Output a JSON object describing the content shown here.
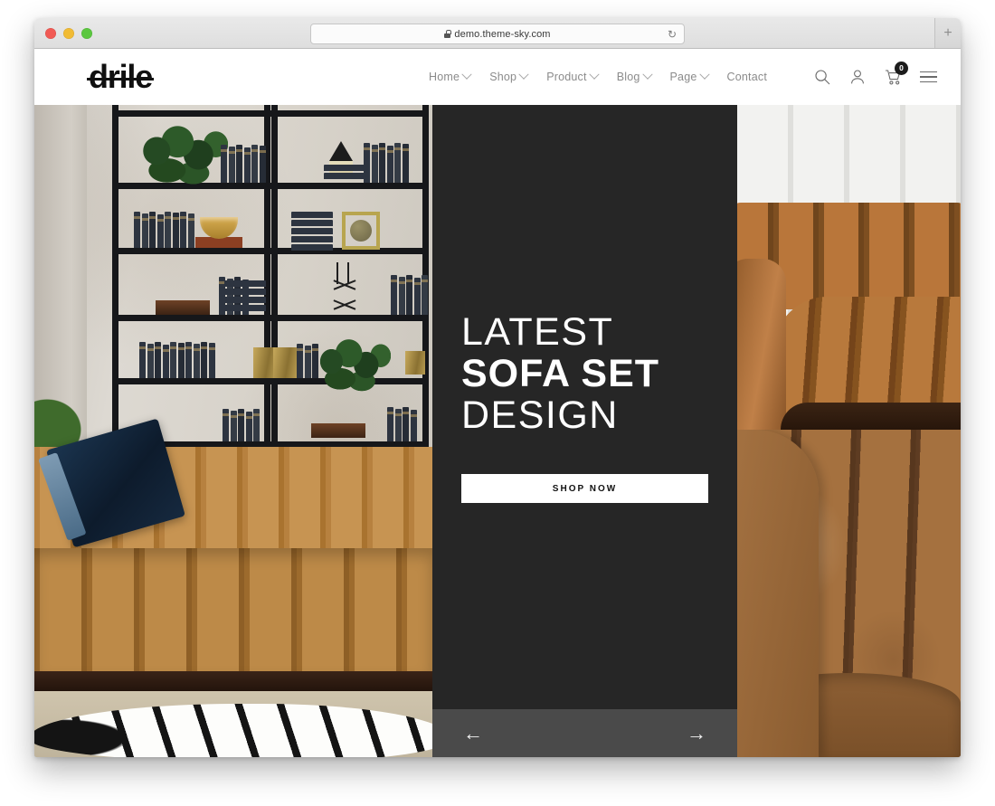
{
  "browser": {
    "url": "demo.theme-sky.com",
    "lock_icon": "lock-icon",
    "reload_icon": "reload-icon",
    "newtab_label": "+",
    "traffic_lights": [
      "close",
      "minimize",
      "zoom"
    ]
  },
  "header": {
    "logo": "drile",
    "nav": [
      {
        "label": "Home",
        "has_dropdown": true
      },
      {
        "label": "Shop",
        "has_dropdown": true
      },
      {
        "label": "Product",
        "has_dropdown": true
      },
      {
        "label": "Blog",
        "has_dropdown": true
      },
      {
        "label": "Page",
        "has_dropdown": true
      },
      {
        "label": "Contact",
        "has_dropdown": false
      }
    ],
    "icons": {
      "search": "search-icon",
      "account": "user-icon",
      "cart": "cart-icon",
      "cart_count": "0",
      "menu": "hamburger-icon"
    }
  },
  "hero": {
    "line1": "LATEST",
    "line2": "SOFA SET",
    "line3": "DESIGN",
    "cta_label": "SHOP NOW",
    "prev_arrow": "←",
    "next_arrow": "→",
    "panel_bg": "#262626",
    "arrows_bg": "#4a4a4a",
    "cta_bg": "#ffffff",
    "cta_color": "#111111",
    "left_image_alt": "living room with black bookshelf, books, plants and tan leather channel sofa on zebra rug",
    "right_top_image_alt": "brown leather channel tufted sofa corner against white panelled wall",
    "right_bottom_image_alt": "close up of tan leather channel tufted upholstery"
  }
}
